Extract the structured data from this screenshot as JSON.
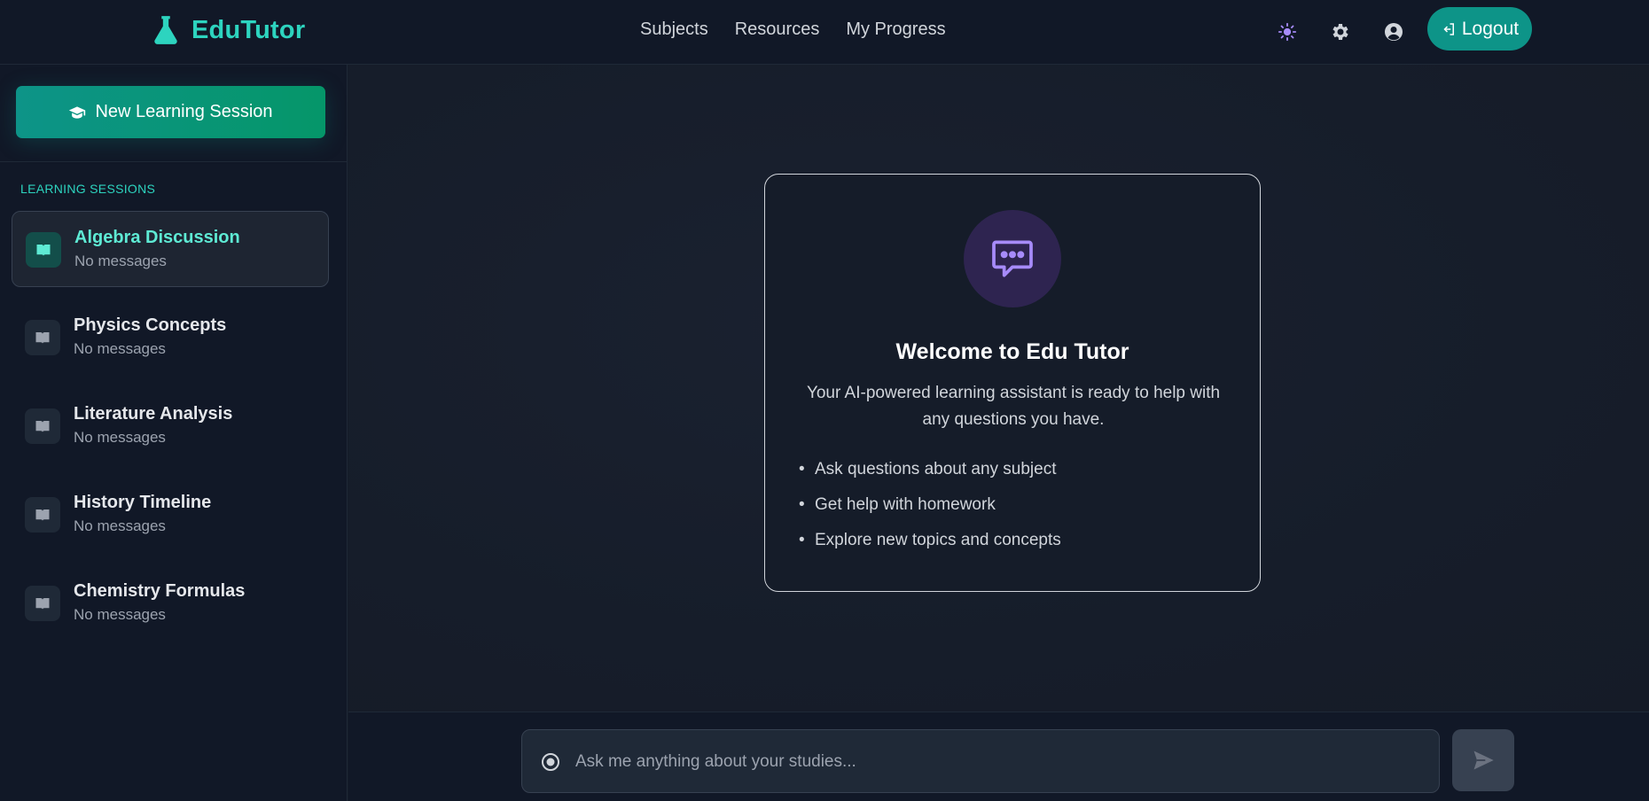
{
  "header": {
    "logo_text": "EduTutor",
    "logo_icon": "flask-icon",
    "nav": [
      {
        "label": "Subjects"
      },
      {
        "label": "Resources"
      },
      {
        "label": "My Progress"
      }
    ],
    "icons": [
      "sun-icon",
      "gear-icon",
      "user-circle-icon"
    ],
    "logout_label": "Logout"
  },
  "sidebar": {
    "new_session_label": "New Learning Session",
    "section_label": "LEARNING SESSIONS",
    "sessions": [
      {
        "title": "Algebra Discussion",
        "subtitle": "No messages",
        "active": true
      },
      {
        "title": "Physics Concepts",
        "subtitle": "No messages",
        "active": false
      },
      {
        "title": "Literature Analysis",
        "subtitle": "No messages",
        "active": false
      },
      {
        "title": "History Timeline",
        "subtitle": "No messages",
        "active": false
      },
      {
        "title": "Chemistry Formulas",
        "subtitle": "No messages",
        "active": false
      }
    ]
  },
  "welcome": {
    "icon": "chat-bubble-icon",
    "title": "Welcome to Edu Tutor",
    "description": "Your AI-powered learning assistant is ready to help with any questions you have.",
    "features": [
      "Ask questions about any subject",
      "Get help with homework",
      "Explore new topics and concepts"
    ]
  },
  "chat_input": {
    "placeholder": "Ask me anything about your studies...",
    "value": ""
  },
  "colors": {
    "accent": "#2dd4bf",
    "button": "#0d9488",
    "purple_icon": "#a78bfa"
  }
}
